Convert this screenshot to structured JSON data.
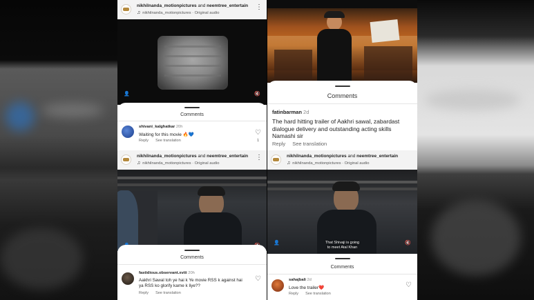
{
  "reels": {
    "top_left": {
      "header": {
        "author1": "nikhilnanda_motionpictures",
        "joiner": "and",
        "author2": "neemtree_entertain",
        "audio": "nikhilnanda_motionpictures · Original audio"
      },
      "comments_title": "Comments",
      "comment": {
        "user": "shivani_kalghatkar",
        "time": "20h",
        "text": "Waiting for this movie ",
        "emoji1": "🔥",
        "emoji2": "💙",
        "reply": "Reply",
        "see_translation": "See translation",
        "likes": "1"
      }
    },
    "top_right": {
      "comments_title": "Comments",
      "comment": {
        "user": "fatinbarman",
        "time": "2d",
        "text": "The hard hitting trailer of Aakhri sawal, zabardast dialogue delivery and outstanding acting skills Namashi sir",
        "reply": "Reply",
        "see_translation": "See translation"
      }
    },
    "bottom_left": {
      "header": {
        "author1": "nikhilnanda_motionpictures",
        "joiner": "and",
        "author2": "neemtree_entertain",
        "audio": "nikhilnanda_motionpictures · Original audio"
      },
      "comments_title": "Comments",
      "comment": {
        "user": "fastidious.observant.xviii",
        "time": "20h",
        "text": "Aakhri Sawal toh ye hai k Ye movie RSS k against hai ya RSS ko glorify karne k liye??",
        "reply": "Reply",
        "see_translation": "See translation"
      }
    },
    "bottom_right": {
      "header": {
        "author1": "nikhilnanda_motionpictures",
        "joiner": "and",
        "author2": "neemtree_entertain",
        "audio": "nikhilnanda_motionpictures · Original audio"
      },
      "subtitle_line1": "That Shivaji is going",
      "subtitle_line2": "to meet Atal Khan",
      "comments_title": "Comments",
      "comment": {
        "user": "sahajbali",
        "time": "2d",
        "text": "Love the trailer",
        "emoji": "❤️",
        "reply": "Reply",
        "see_translation": "See translation"
      }
    }
  },
  "colors": {
    "accent_text": "#222222",
    "muted_text": "#666666",
    "sheet_bg": "#ffffff"
  },
  "icons": [
    "music-note-icon",
    "more-options-icon",
    "heart-icon",
    "mute-icon",
    "person-icon"
  ]
}
